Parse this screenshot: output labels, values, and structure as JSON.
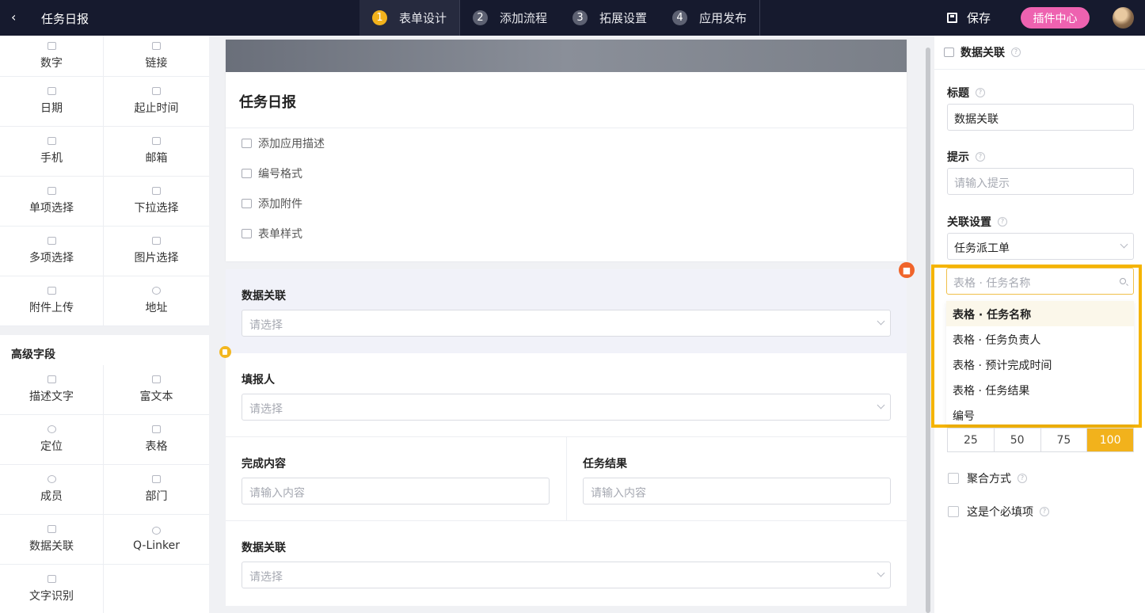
{
  "header": {
    "back_icon": "chevron-left-icon",
    "title": "任务日报",
    "steps": [
      {
        "num": "1",
        "label": "表单设计"
      },
      {
        "num": "2",
        "label": "添加流程"
      },
      {
        "num": "3",
        "label": "拓展设置"
      },
      {
        "num": "4",
        "label": "应用发布"
      }
    ],
    "save_label": "保存",
    "plugin_label": "插件中心"
  },
  "palette": {
    "basic": [
      "数字",
      "链接",
      "日期",
      "起止时间",
      "手机",
      "邮箱",
      "单项选择",
      "下拉选择",
      "多项选择",
      "图片选择",
      "附件上传",
      "地址"
    ],
    "advanced_title": "高级字段",
    "advanced": [
      "描述文字",
      "富文本",
      "定位",
      "表格",
      "成员",
      "部门",
      "数据关联",
      "Q-Linker",
      "文字识别"
    ]
  },
  "form": {
    "title": "任务日报",
    "options": [
      "添加应用描述",
      "编号格式",
      "添加附件",
      "表单样式"
    ],
    "fields": {
      "f1_label": "数据关联",
      "f1_placeholder": "请选择",
      "f2_label": "填报人",
      "f2_placeholder": "请选择",
      "f3_label": "完成内容",
      "f3_placeholder": "请输入内容",
      "f4_label": "任务结果",
      "f4_placeholder": "请输入内容",
      "f5_label": "数据关联",
      "f5_placeholder": "请选择"
    },
    "delete_icon": "trash-icon",
    "copy_icon": "copy-icon"
  },
  "panel": {
    "title": "数据关联",
    "title_label": "标题",
    "title_value": "数据关联",
    "hint_label": "提示",
    "hint_placeholder": "请输入提示",
    "link_label": "关联设置",
    "link_value": "任务派工单",
    "search_placeholder": "表格 · 任务名称",
    "dropdown": [
      "表格 · 任务名称",
      "表格 · 任务负责人",
      "表格 · 预计完成时间",
      "表格 · 任务结果",
      "编号"
    ],
    "widths": [
      "25",
      "50",
      "75",
      "100"
    ],
    "aggregate_label": "聚合方式",
    "required_label": "这是个必填项"
  },
  "colors": {
    "accent": "#f2b21c",
    "topbar": "#161a2e",
    "plugin": "#ee62b0",
    "highlight": "#f5b400"
  }
}
